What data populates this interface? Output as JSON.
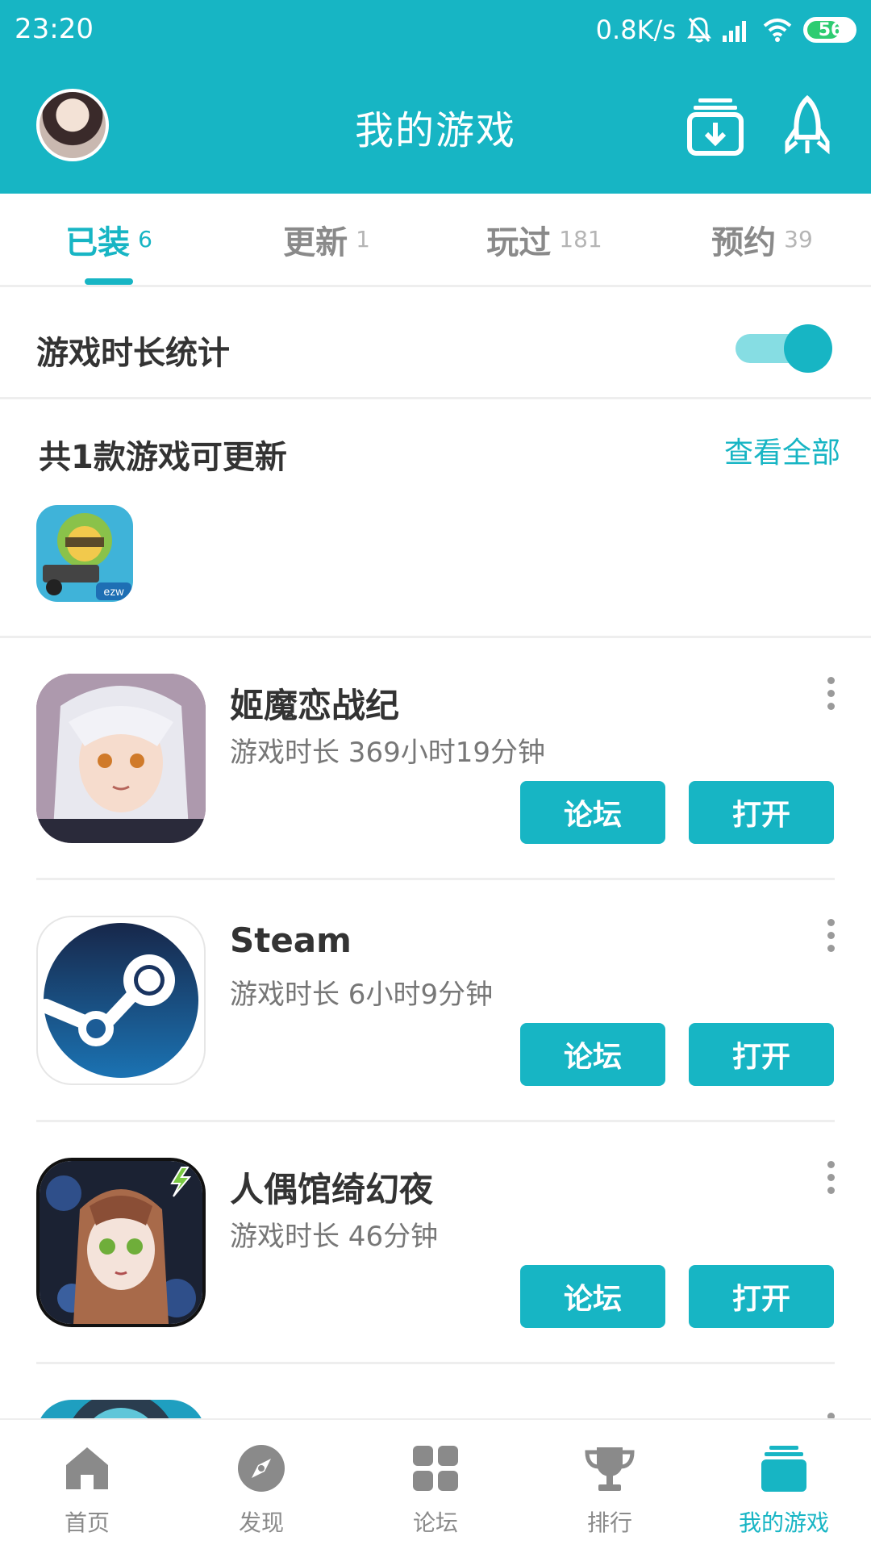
{
  "status_bar": {
    "time": "23:20",
    "network_speed": "0.8K/s",
    "battery": "56",
    "icons": [
      "bell-off-icon",
      "signal-icon",
      "wifi-icon",
      "battery-icon"
    ]
  },
  "header": {
    "title": "我的游戏",
    "avatar_icon": "avatar",
    "actions": [
      "download-manager-icon",
      "rocket-icon"
    ]
  },
  "tabs": [
    {
      "label": "已装",
      "count": "6",
      "active": true
    },
    {
      "label": "更新",
      "count": "1",
      "active": false
    },
    {
      "label": "玩过",
      "count": "181",
      "active": false
    },
    {
      "label": "预约",
      "count": "39",
      "active": false
    }
  ],
  "playtime_stats": {
    "label": "游戏时长统计",
    "enabled": true
  },
  "updates": {
    "heading": "共1款游戏可更新",
    "view_all": "查看全部",
    "icon_badge": "ezw"
  },
  "games": [
    {
      "name": "姬魔恋战纪",
      "playtime": "游戏时长 369小时19分钟",
      "forum_label": "论坛",
      "open_label": "打开"
    },
    {
      "name": "Steam",
      "playtime": "游戏时长 6小时9分钟",
      "forum_label": "论坛",
      "open_label": "打开"
    },
    {
      "name": "人偶馆绮幻夜",
      "playtime": "游戏时长 46分钟",
      "forum_label": "论坛",
      "open_label": "打开"
    }
  ],
  "bottom_nav": [
    {
      "label": "首页",
      "icon": "home-icon",
      "active": false
    },
    {
      "label": "发现",
      "icon": "compass-icon",
      "active": false
    },
    {
      "label": "论坛",
      "icon": "grid-icon",
      "active": false
    },
    {
      "label": "排行",
      "icon": "trophy-icon",
      "active": false
    },
    {
      "label": "我的游戏",
      "icon": "my-games-icon",
      "active": true
    }
  ],
  "colors": {
    "accent": "#17b5c4",
    "toggle_track": "#86dde3",
    "text_primary": "#333333",
    "text_secondary": "#777777"
  }
}
